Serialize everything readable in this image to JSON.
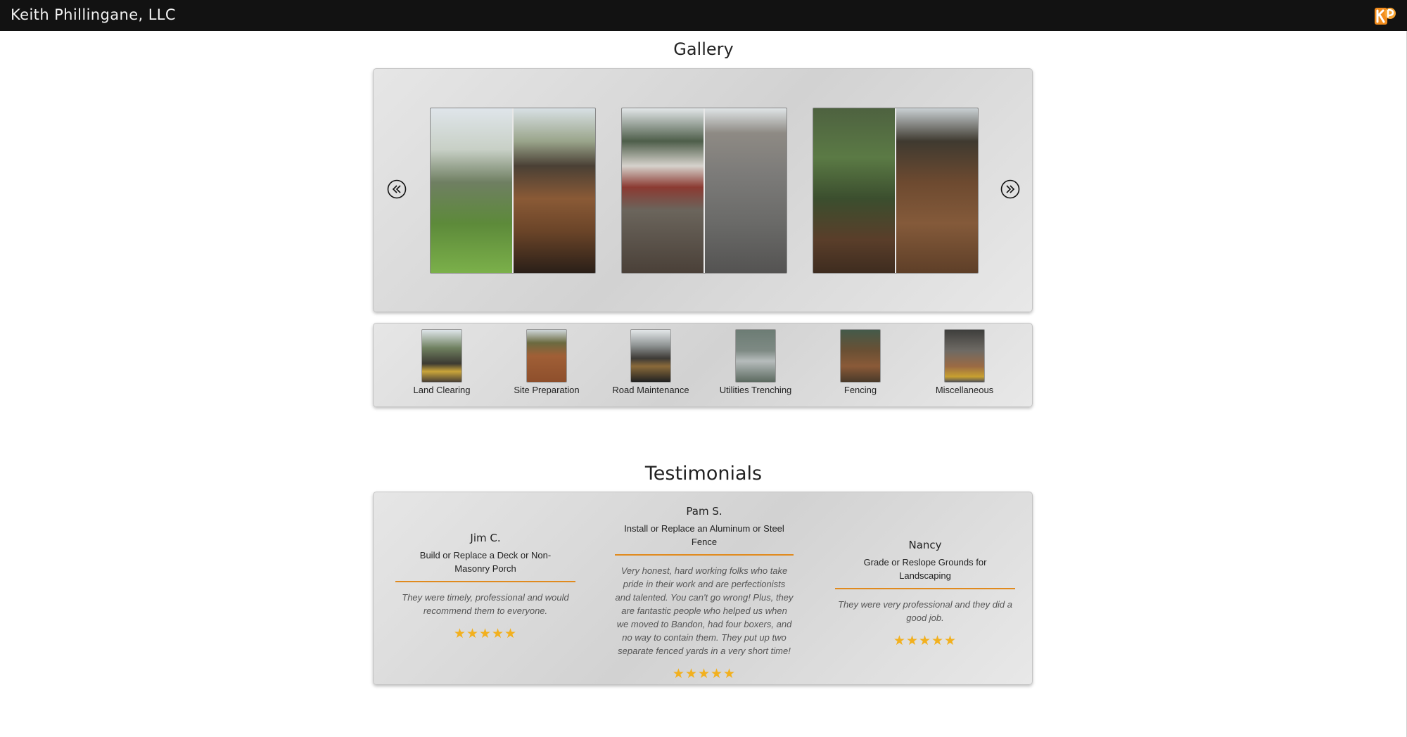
{
  "header": {
    "brand": "Keith Phillingane, LLC",
    "logo_icon": "kp-logo-icon"
  },
  "gallery": {
    "title": "Gallery",
    "prev_icon": "chevron-double-left-icon",
    "next_icon": "chevron-double-right-icon",
    "categories": [
      {
        "label": "Land Clearing"
      },
      {
        "label": "Site Preparation"
      },
      {
        "label": "Road Maintenance"
      },
      {
        "label": "Utilities Trenching"
      },
      {
        "label": "Fencing"
      },
      {
        "label": "Miscellaneous"
      }
    ]
  },
  "testimonials": {
    "title": "Testimonials",
    "items": [
      {
        "name": "Jim C.",
        "service": "Build or Replace a Deck or Non-Masonry Porch",
        "quote": "They were timely, professional and would recommend them to everyone.",
        "stars": "★★★★★"
      },
      {
        "name": "Pam S.",
        "service": "Install or Replace an Aluminum or Steel Fence",
        "quote": "Very honest, hard working folks who take pride in their work and are perfectionists and talented. You can't go wrong! Plus, they are fantastic people who helped us when we moved to Bandon, had four boxers, and no way to contain them. They put up two separate fenced yards in a very short time!",
        "stars": "★★★★★"
      },
      {
        "name": "Nancy",
        "service": "Grade or Reslope Grounds for Landscaping",
        "quote": "They were very professional and they did a good job.",
        "stars": "★★★★★"
      }
    ]
  },
  "colors": {
    "header_bg": "#121212",
    "accent": "#e08a1e",
    "star": "#f2b01e"
  }
}
